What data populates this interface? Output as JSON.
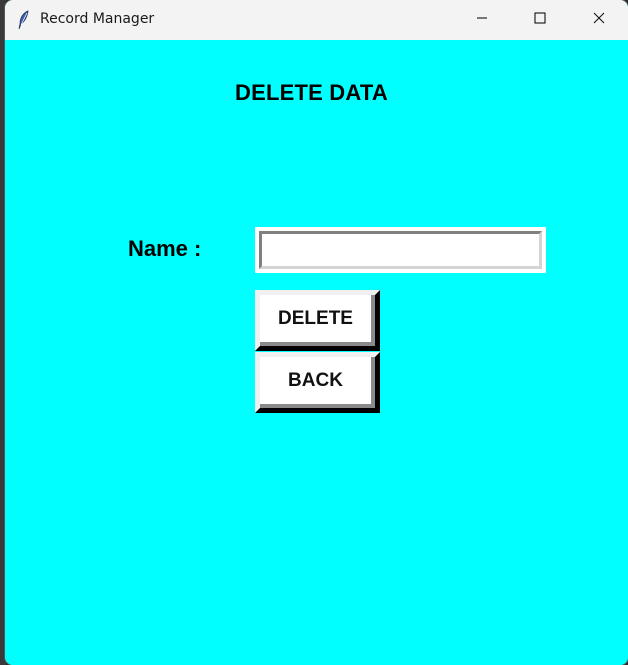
{
  "window": {
    "title": "Record Manager",
    "background_color": "#00ffff"
  },
  "icons": {
    "app": "feather-icon",
    "minimize": "minimize-icon",
    "maximize": "maximize-icon",
    "close": "close-icon"
  },
  "form": {
    "heading": "DELETE DATA",
    "name_label": "Name :",
    "name_value": "",
    "delete_label": "DELETE",
    "back_label": "BACK"
  }
}
